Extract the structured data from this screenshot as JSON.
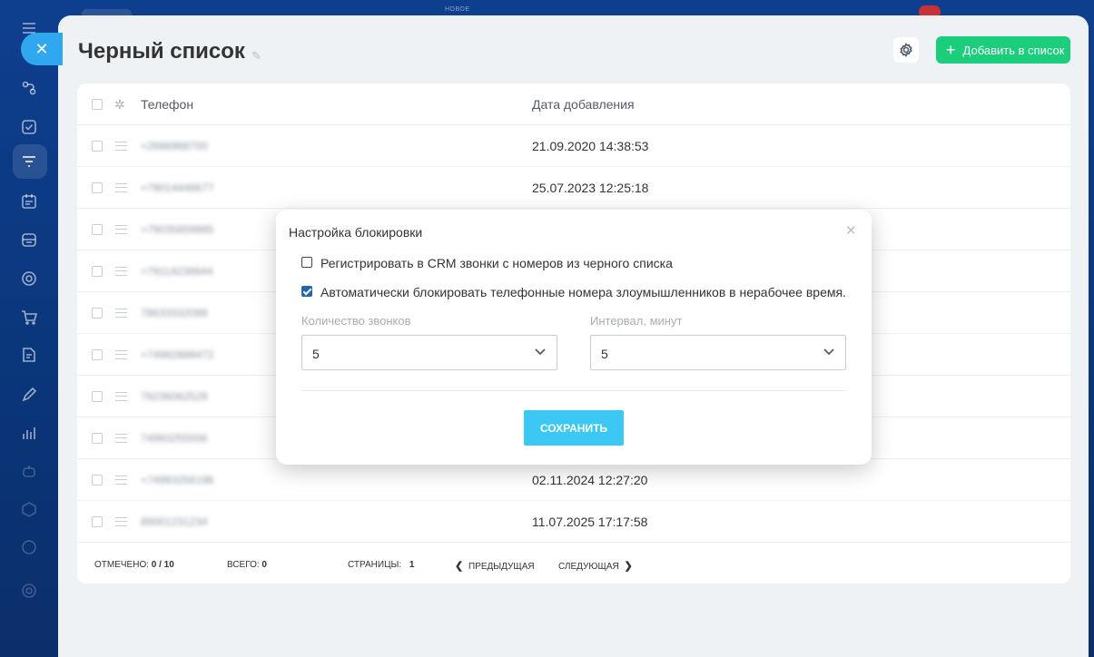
{
  "topbar": {
    "label": "НОВОЕ"
  },
  "page": {
    "title": "Черный список",
    "add_button_label": "Добавить в список"
  },
  "table": {
    "columns": [
      "Телефон",
      "Дата добавления"
    ],
    "rows": [
      {
        "phone": "+2666968700",
        "date": "21.09.2020 14:38:53"
      },
      {
        "phone": "+79014446677",
        "date": "25.07.2023 12:25:18"
      },
      {
        "phone": "+79035659985",
        "date": ""
      },
      {
        "phone": "+79114236644",
        "date": ""
      },
      {
        "phone": "78633332099",
        "date": ""
      },
      {
        "phone": "+74992888472",
        "date": ""
      },
      {
        "phone": "79236062529",
        "date": ""
      },
      {
        "phone": "74993255556",
        "date": ""
      },
      {
        "phone": "+74993256196",
        "date": "02.11.2024 12:27:20"
      },
      {
        "phone": "89001231234",
        "date": "11.07.2025 17:17:58"
      }
    ]
  },
  "footer": {
    "selected_label": "ОТМЕЧЕНО:",
    "selected_value": "0 / 10",
    "total_label": "ВСЕГО:",
    "total_value": "0",
    "pages_label": "СТРАНИЦЫ:",
    "pages_value": "1",
    "prev_label": "ПРЕДЫДУЩАЯ",
    "next_label": "СЛЕДУЮЩАЯ"
  },
  "dialog": {
    "title": "Настройка блокировки",
    "option1_label": "Регистрировать в CRM звонки с номеров из черного списка",
    "option1_checked": false,
    "option2_label": "Автоматически блокировать телефонные номера злоумышленников в нерабочее время.",
    "option2_checked": true,
    "calls_label": "Количество звонков",
    "calls_value": "5",
    "interval_label": "Интервал, минут",
    "interval_value": "5",
    "save_label": "СОХРАНИТЬ"
  },
  "colors": {
    "accent_green": "#1bce7b",
    "accent_blue": "#3bc8f5",
    "rail_blue": "#0e3f8f"
  }
}
